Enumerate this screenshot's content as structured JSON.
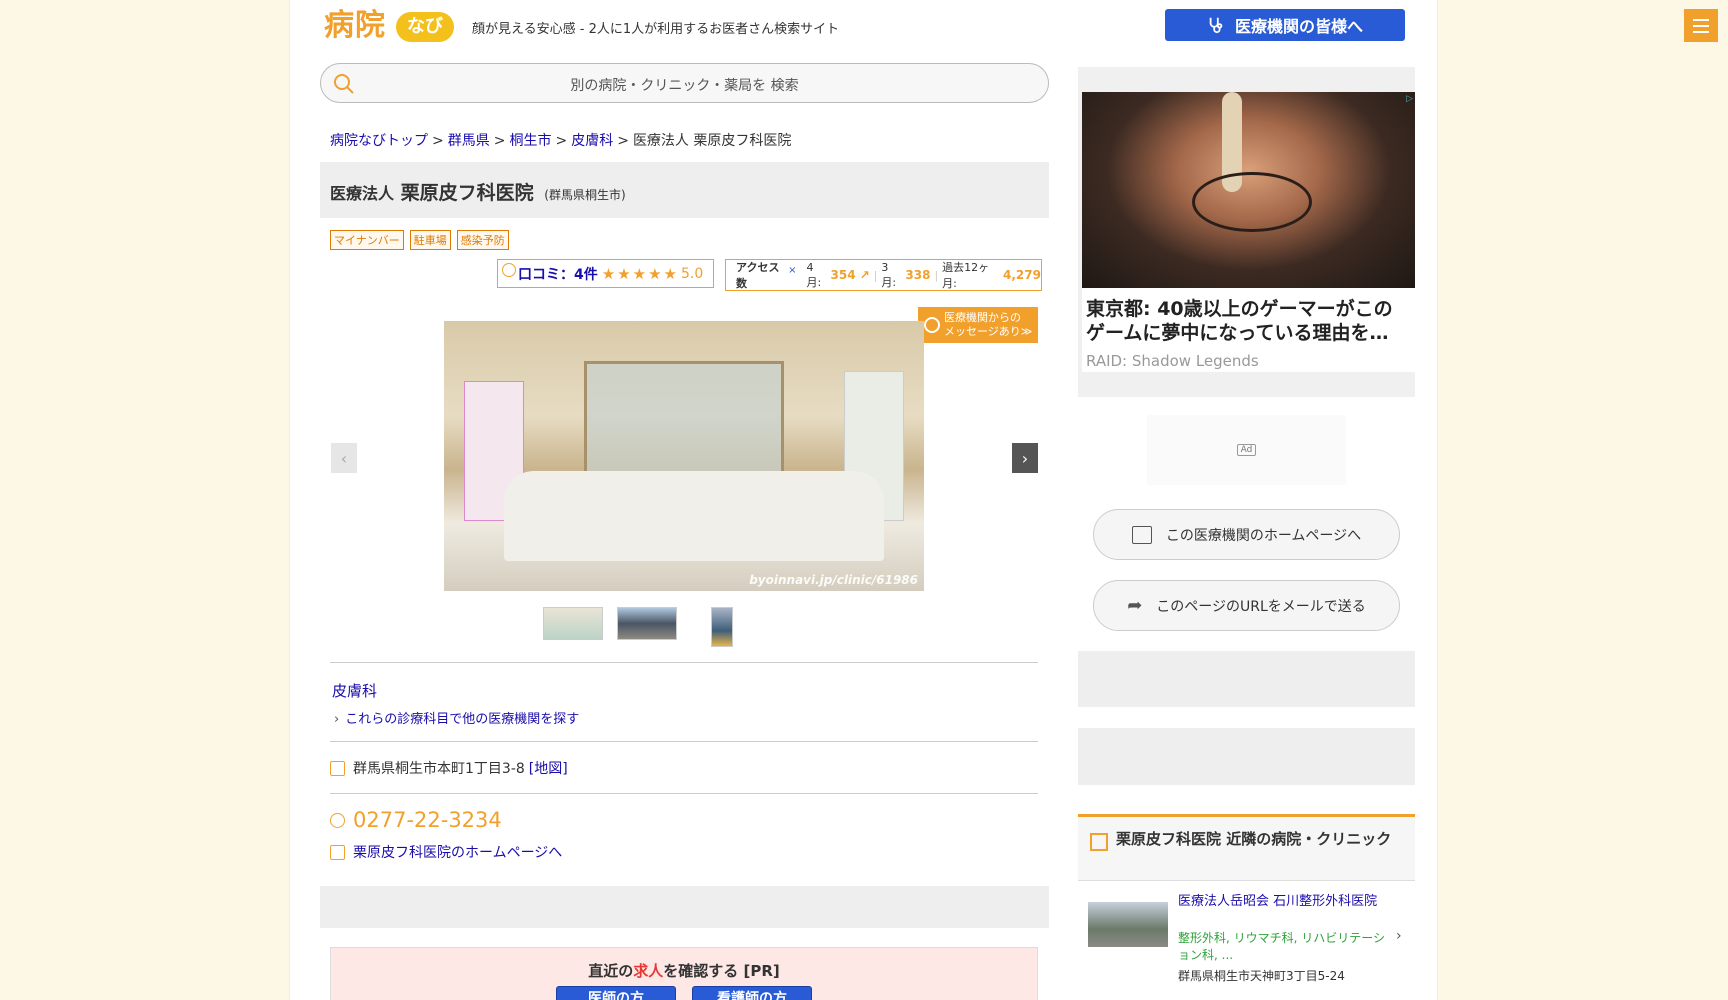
{
  "header": {
    "logo_text": "病院",
    "logo_pill": "なび",
    "tagline": "顔が見える安心感 - 2人に1人が利用するお医者さん検索サイト",
    "medical_button": "医療機関の皆様へ"
  },
  "search": {
    "placeholder": "別の病院・クリニック・薬局を 検索"
  },
  "breadcrumb": {
    "items": [
      "病院なびトップ",
      "群馬県",
      "桐生市",
      "皮膚科"
    ],
    "current": "医療法人 栗原皮フ科医院"
  },
  "clinic": {
    "prefix": "医療法人",
    "name": "栗原皮フ科医院",
    "location": "(群馬県桐生市)",
    "tags": [
      "マイナンバー",
      "駐車場",
      "感染予防"
    ],
    "review_label": "口コミ：4件",
    "stars": "★★★★★",
    "score": "5.0",
    "access_label": "アクセス数",
    "access_close": "×",
    "access_apr_label": "4月:",
    "access_apr": "354",
    "access_mar_label": "3月:",
    "access_mar": "338",
    "access_12m_label": "過去12ヶ月:",
    "access_12m": "4,279",
    "message_badge_line1": "医療機関からの",
    "message_badge_line2": "メッセージあり≫",
    "photo_watermark": "byoinnavi.jp/clinic/61986",
    "department": "皮膚科",
    "dept_search": "これらの診療科目で他の医療機関を探す",
    "address": "群馬県桐生市本町1丁目3-8",
    "map_link": "[地図]",
    "phone": "0277-22-3234",
    "homepage_link": "栗原皮フ科医院のホームページへ"
  },
  "jobs": {
    "title_pre": "直近の",
    "title_red": "求人",
    "title_post": "を確認する [PR]",
    "btn_doctor": "医師の方",
    "btn_nurse": "看護師の方"
  },
  "sidebar": {
    "ad_headline": "東京都: 40歳以上のゲーマーがこのゲームに夢中になっている理由を…",
    "ad_source": "RAID: Shadow Legends",
    "ad_label": "Ad",
    "homepage_button": "この医療機関のホームページへ",
    "mail_button": "このページのURLをメールで送る",
    "nearby_title": "栗原皮フ科医院 近隣の病院・クリニック",
    "nearby_name": "医療法人岳昭会 石川整形外科医院",
    "nearby_dept": "整形外科, リウマチ科, リハビリテーション科, ...",
    "nearby_addr": "群馬県桐生市天神町3丁目5-24"
  },
  "colors": {
    "accent": "#f2a02c",
    "link": "#1a0dab",
    "primary_button": "#2a5bd7"
  }
}
